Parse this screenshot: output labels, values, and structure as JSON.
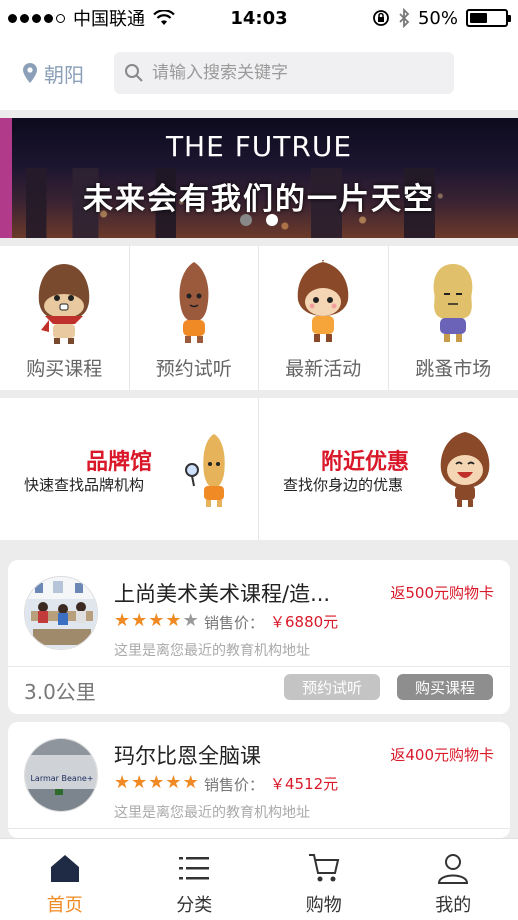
{
  "status_bar": {
    "carrier": "中国联通",
    "time": "14:03",
    "battery": "50%",
    "battery_fraction": 0.5
  },
  "header": {
    "location": "朝阳",
    "search_placeholder": "请输入搜索关键字"
  },
  "banner": {
    "title": "THE FUTRUE",
    "subtitle": "未来会有我们的一片天空",
    "slides": 2,
    "active_slide": 2
  },
  "categories": [
    {
      "label": "购买课程",
      "icon": "chestnut-scarf-icon"
    },
    {
      "label": "预约试听",
      "icon": "almond-character-icon"
    },
    {
      "label": "最新活动",
      "icon": "chestnut-kid-icon"
    },
    {
      "label": "跳蚤市场",
      "icon": "peanut-character-icon"
    }
  ],
  "promos": [
    {
      "title": "品牌馆",
      "subtitle": "快速查找品牌机构"
    },
    {
      "title": "附近优惠",
      "subtitle": "查找你身边的优惠"
    }
  ],
  "listings": [
    {
      "title": "上尚美术美术课程/造...",
      "badge": "返500元购物卡",
      "rating": 4,
      "price_label": "销售价：",
      "price": "￥6880元",
      "address": "这里是离您最近的教育机构地址",
      "distance": "3.0公里",
      "trial_label": "预约试听",
      "buy_label": "购买课程"
    },
    {
      "title": "玛尔比恩全脑课",
      "badge": "返400元购物卡",
      "rating": 5,
      "price_label": "销售价：",
      "price": "￥4512元",
      "address": "这里是离您最近的教育机构地址",
      "avatar_text": "Larmar Beane+"
    }
  ],
  "tabbar": [
    {
      "label": "首页",
      "icon": "home-icon",
      "active": true
    },
    {
      "label": "分类",
      "icon": "list-icon",
      "active": false
    },
    {
      "label": "购物",
      "icon": "cart-icon",
      "active": false
    },
    {
      "label": "我的",
      "icon": "user-icon",
      "active": false
    }
  ],
  "colors": {
    "accent_red": "#d9192a",
    "accent_orange": "#f08a24",
    "location_blue": "#8ba0b8"
  }
}
